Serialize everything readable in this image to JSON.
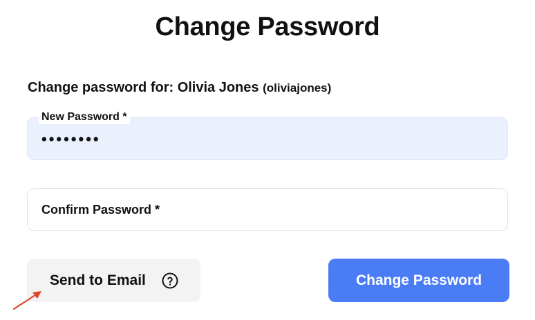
{
  "page": {
    "title": "Change Password"
  },
  "form": {
    "subtitle_prefix": "Change password for: Olivia Jones",
    "username": "(oliviajones)",
    "new_password": {
      "label": "New Password *",
      "value": "••••••••"
    },
    "confirm_password": {
      "label": "Confirm Password *",
      "value": ""
    }
  },
  "actions": {
    "send_email_label": "Send to Email",
    "help_icon": "question-circle-icon",
    "submit_label": "Change Password"
  },
  "annotation": {
    "arrow_color": "#e0452b"
  },
  "colors": {
    "primary": "#4a7cf6",
    "filled_field_bg": "#ebf0fd",
    "secondary_button_bg": "#f3f3f3"
  }
}
